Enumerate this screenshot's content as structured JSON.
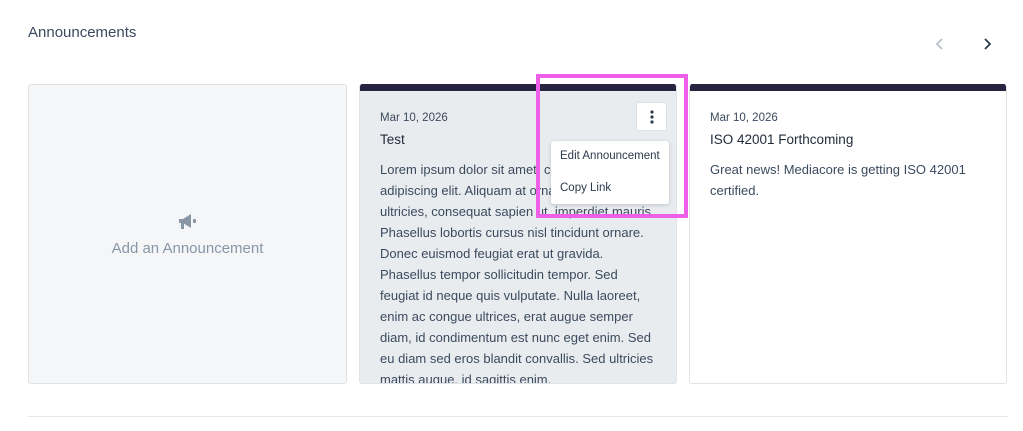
{
  "section": {
    "title": "Announcements"
  },
  "nav": {
    "prev_icon": "chevron-left-icon",
    "next_icon": "chevron-right-icon"
  },
  "add_card": {
    "label": "Add an Announcement",
    "icon": "megaphone-icon"
  },
  "announcements": [
    {
      "date": "Mar 10, 2026",
      "title": "Test",
      "body": "Lorem ipsum dolor sit amet, consectetur adipiscing elit. Aliquam at ornare dui, quis risus ultricies, consequat sapien ut, imperdiet mauris. Phasellus lobortis cursus nisl tincidunt ornare. Donec euismod feugiat erat ut gravida. Phasellus tempor sollicitudin tempor. Sed feugiat id neque quis vulputate. Nulla laoreet, enim ac congue ultrices, erat augue semper diam, id condimentum est nunc eget enim. Sed eu diam sed eros blandit convallis. Sed ultricies mattis augue, id sagittis enim."
    },
    {
      "date": "Mar 10, 2026",
      "title": "ISO 42001 Forthcoming",
      "body": "Great news! Mediacore is getting ISO 42001 certified."
    }
  ],
  "context_menu": {
    "items": [
      "Edit Announcement",
      "Copy Link"
    ]
  },
  "colors": {
    "card_accent": "#26243f",
    "highlight": "#ee5ee8"
  }
}
